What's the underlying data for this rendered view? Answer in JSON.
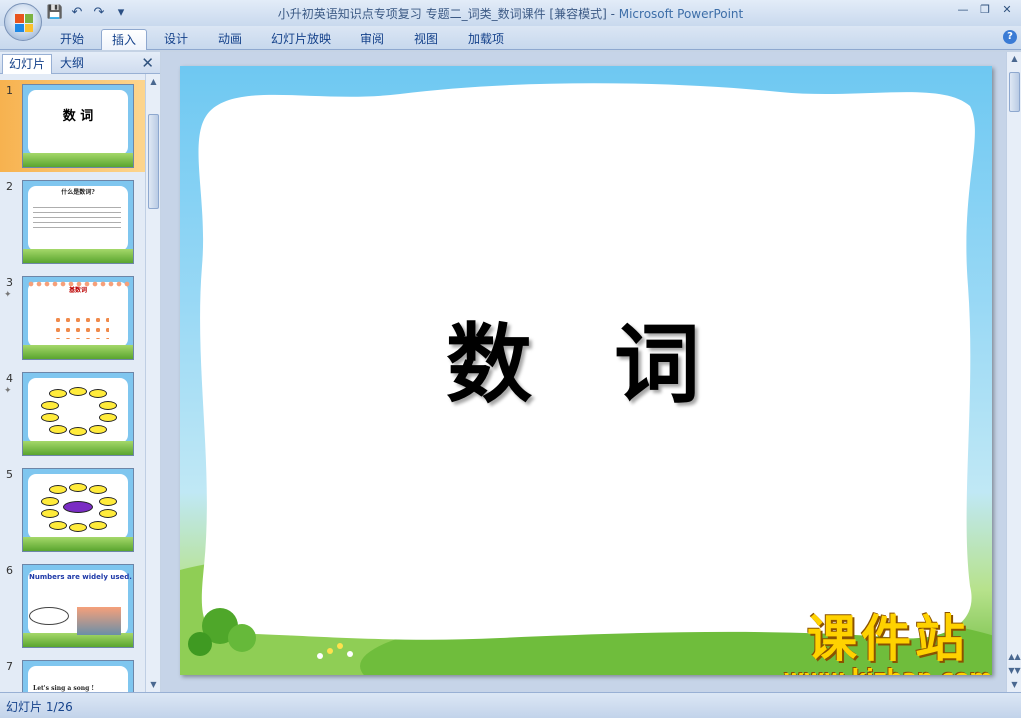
{
  "window": {
    "title": "小升初英语知识点专项复习 专题二_词类_数词课件 [兼容模式] - ",
    "app_name": "Microsoft PowerPoint"
  },
  "quick_access": {
    "save_icon": "save-icon",
    "undo_icon": "undo-icon",
    "redo_icon": "redo-icon",
    "customize_icon": "dropdown-icon"
  },
  "ribbon": {
    "tabs": [
      "开始",
      "插入",
      "设计",
      "动画",
      "幻灯片放映",
      "审阅",
      "视图",
      "加载项"
    ],
    "active_tab": "插入"
  },
  "left_pane": {
    "tabs": [
      "幻灯片",
      "大纲"
    ],
    "active_tab": "幻灯片",
    "slides": [
      {
        "num": "1",
        "title": "数 词",
        "selected": true
      },
      {
        "num": "2",
        "title": "什么是数词?"
      },
      {
        "num": "3",
        "title": "基数词"
      },
      {
        "num": "4",
        "title": ""
      },
      {
        "num": "5",
        "title": ""
      },
      {
        "num": "6",
        "title": "Numbers are widely used."
      },
      {
        "num": "7",
        "title": "Let's sing a song !"
      }
    ]
  },
  "slide": {
    "title": "数 词"
  },
  "watermark": {
    "brand": "课件站",
    "url": "www.kjzhan.com"
  },
  "status": {
    "slide_counter": "幻灯片 1/26"
  },
  "colors": {
    "ribbon_text": "#15428b",
    "selected_thumb": "#f7b24f",
    "watermark": "#ffd200"
  }
}
